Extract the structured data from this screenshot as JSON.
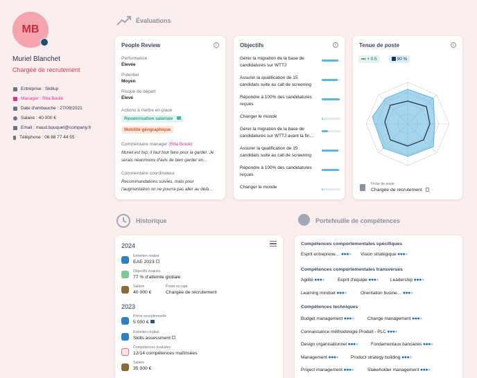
{
  "profile": {
    "initials": "MB",
    "name": "Muriel Blanchet",
    "role": "Chargée de recrutement",
    "company": "Entreprise : Skillup",
    "manager": "Manager : Rita Boulé",
    "hire_date": "Date d'embauche : 27/09/2021",
    "salary": "Salaire : 40 000 €",
    "email": "Email : maud.bouquet@company.fr",
    "phone": "Téléphone : 06 88 77 44 55"
  },
  "evaluations": {
    "heading": "Évaluations",
    "people_review": {
      "title": "People Review",
      "performance_label": "Performance",
      "performance_value": "Élevée",
      "potential_label": "Potentiel",
      "potential_value": "Moyen",
      "risk_label": "Risque de départ",
      "risk_value": "Élevé",
      "actions_label": "Actions à mettre en place",
      "action1": "Revalorisation salariale",
      "action2": "Mobilité géographique",
      "manager_comment_label": "Commentaire manager",
      "manager_name": "(Rita Boulé)",
      "manager_comment": "Muriel est top, il faut tout faire pour la garder. Je serais néanmoins d'avis de bien garder en…",
      "coord_comment_label": "Commentaire coordinateur",
      "coord_comment": "Recommandations suivies, mais pour l'augmentation on ne pourra pas aller au delà…"
    },
    "objectifs": {
      "title": "Objectifs",
      "items": [
        {
          "text": "Gérer la migration de la base de candidatures sur WTTJ",
          "progress": 0.9
        },
        {
          "text": "Assurer la qualification de 15 candidats suite au call de screening",
          "progress": 0.85
        },
        {
          "text": "Répondre à 100% des candidatures reçues",
          "progress": 0.95
        },
        {
          "text": "Changer le monde",
          "progress": 0.05
        },
        {
          "text": "Gérer la migration de la base de candidatures sur WTTJ avant la fin…",
          "progress": 0.35
        },
        {
          "text": "Assurer la qualification de 15 candidats suite au call de screening",
          "progress": 0.9
        },
        {
          "text": "Répondre à 100% des candidatures reçues",
          "progress": 0.92
        },
        {
          "text": "Changer le monde",
          "progress": 0.05
        }
      ]
    },
    "tenue": {
      "title": "Tenue de poste",
      "badge1": "+ 0.5",
      "badge2": "90 %",
      "fiche_label": "Fiche de poste",
      "fiche_value": "Chargée de recrutement"
    }
  },
  "historique": {
    "heading": "Historique",
    "years": [
      {
        "year": "2024",
        "entries": [
          {
            "label": "Entretien réalisé",
            "value": "EAE 2023",
            "color": "#2f7fc1"
          },
          {
            "label": "Objectifs évalués",
            "value": "77 % d'atteinte globale",
            "color": "#7fc88f"
          },
          {
            "label": "Salaire",
            "value": "40 000 €",
            "label2": "Poste occupé",
            "value2": "Chargée de recrutement",
            "color": "#8a6a3a"
          }
        ]
      },
      {
        "year": "2023",
        "entries": [
          {
            "label": "Prime exceptionnelle",
            "value": "5 000 €",
            "color": "#2f7fc1"
          },
          {
            "label": "Entretien réalisé",
            "value": "Skills assessment",
            "color": "#2f7fc1"
          },
          {
            "label": "Compétences évaluées",
            "value": "12/14 compétences maîtrisées",
            "color": "#e06a7a"
          },
          {
            "label": "Salaire",
            "value": "35 000 €",
            "color": "#8a6a3a"
          }
        ]
      }
    ]
  },
  "competences": {
    "heading": "Portefeuille de compétences",
    "groups": [
      {
        "title": "Compétences comportementales spécifiques",
        "skills": [
          [
            "Esprit entreprene…",
            3
          ],
          [
            "Vision stratégique",
            3
          ]
        ]
      },
      {
        "title": "Compétences comportementales transverses",
        "skills": [
          [
            "Agilité",
            3
          ],
          [
            "Esprit d'équipe",
            3
          ],
          [
            "Leadership",
            3
          ],
          [
            "Learning mindset",
            3
          ],
          [
            "Orientation busine…",
            3
          ]
        ]
      },
      {
        "title": "Compétences techniques",
        "skills": [
          [
            "Budget management",
            3
          ],
          [
            "Change management",
            3
          ],
          [
            "Connaissance méthodologie Produit - PLC",
            3
          ],
          [
            "Design organisationnel",
            3
          ],
          [
            "Fondamentaux bancaires",
            3
          ],
          [
            "Management",
            3
          ],
          [
            "Product strategy building",
            3
          ],
          [
            "Project management",
            3
          ],
          [
            "Stakeholder management",
            3
          ]
        ]
      }
    ]
  },
  "colors": {
    "accent": "#e8394f",
    "manager": "#e0308a",
    "blue": "#5bb5de"
  }
}
